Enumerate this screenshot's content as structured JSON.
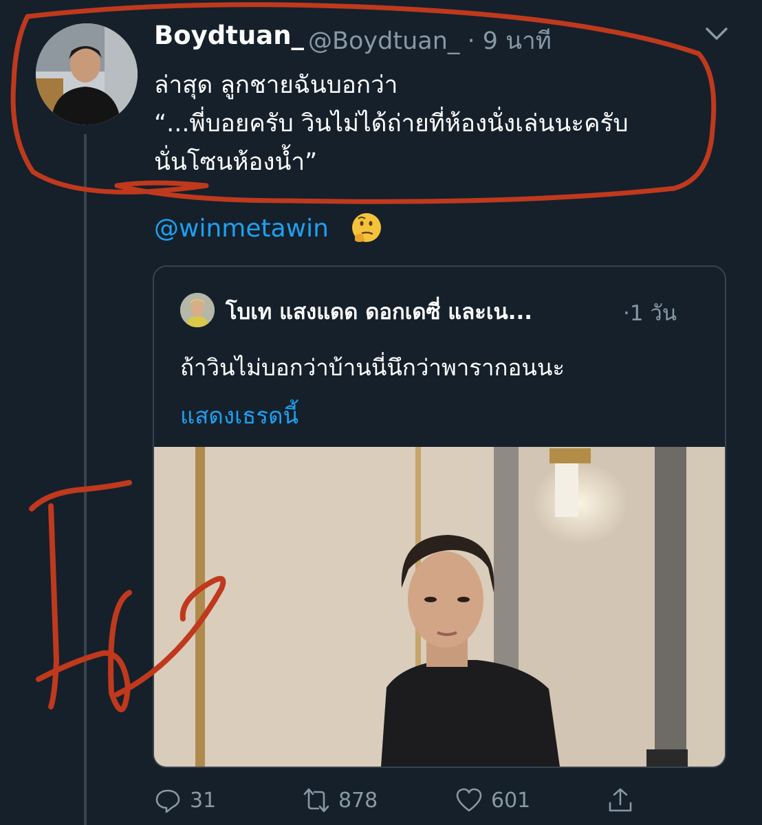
{
  "tweet": {
    "author_name": "Boydtuan_",
    "author_handle_time": "@Boydtuan_ · 9 นาที",
    "lines": [
      "ล่าสุด ลูกชายฉันบอกว่า",
      "“...พี่บอยครับ วินไม่ได้ถ่ายที่ห้องนั่งเล่นนะครับ",
      "นั่นโซนห้องน้ำ”"
    ],
    "mention": "@winmetawin",
    "emoji": "thinking-face-emoji"
  },
  "quoted": {
    "author_name": "โบเท แสงแดด ดอกเดซี่ และเน...",
    "time": "·1 วัน",
    "text": "ถ้าวินไม่บอกว่าบ้านนี่นึกว่าพารากอนนะ",
    "show_thread": "แสดงเธรดนี้"
  },
  "actions": {
    "reply_count": "31",
    "retweet_count": "878",
    "like_count": "601"
  },
  "colors": {
    "background": "#15202b",
    "link": "#1da1f2",
    "muted": "#8899a6",
    "annotation": "#c0391d"
  },
  "icons": [
    "chevron-down-icon",
    "reply-icon",
    "retweet-icon",
    "like-icon",
    "share-icon"
  ]
}
